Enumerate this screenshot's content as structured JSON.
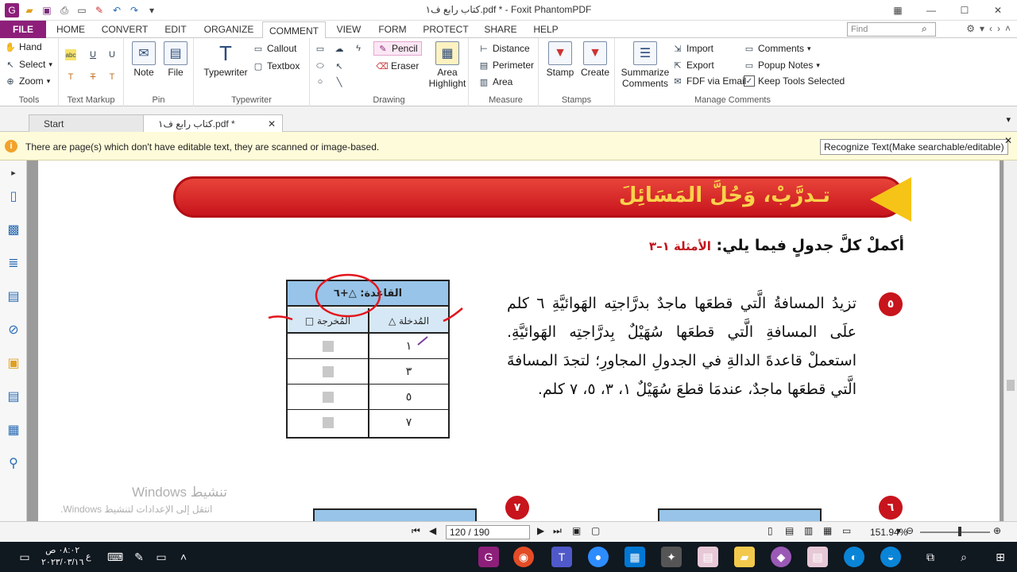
{
  "window": {
    "title": "كتاب رابع ف١.pdf * - Foxit PhantomPDF",
    "qat_icons": [
      "pdf-app-icon",
      "open-folder-icon",
      "save-icon",
      "print-icon",
      "scan-icon",
      "undo-icon",
      "redo-icon",
      "customize-icon"
    ],
    "controls": [
      "restore-icon",
      "minimize-icon",
      "maximize-icon",
      "close-icon"
    ]
  },
  "menu": {
    "file": "FILE",
    "tabs": [
      "HOME",
      "CONVERT",
      "EDIT",
      "ORGANIZE",
      "COMMENT",
      "VIEW",
      "FORM",
      "PROTECT",
      "SHARE",
      "HELP"
    ],
    "active_tab": "COMMENT",
    "find_placeholder": "Find"
  },
  "ribbon": {
    "tools": {
      "hand": "Hand",
      "select": "Select",
      "zoom": "Zoom",
      "label": "Tools"
    },
    "text_markup": {
      "label": "Text Markup"
    },
    "pin": {
      "note": "Note",
      "file": "File",
      "label": "Pin"
    },
    "typewriter": {
      "typewriter": "Typewriter",
      "callout": "Callout",
      "textbox": "Textbox",
      "label": "Typewriter"
    },
    "drawing": {
      "pencil": "Pencil",
      "eraser": "Eraser",
      "area_highlight_1": "Area",
      "area_highlight_2": "Highlight",
      "label": "Drawing"
    },
    "measure": {
      "distance": "Distance",
      "perimeter": "Perimeter",
      "area": "Area",
      "label": "Measure"
    },
    "stamps": {
      "stamp": "Stamp",
      "create": "Create",
      "label": "Stamps"
    },
    "manage": {
      "summarize_1": "Summarize",
      "summarize_2": "Comments",
      "import": "Import",
      "export": "Export",
      "fdf_email": "FDF via Email",
      "comments": "Comments",
      "popup_notes": "Popup Notes",
      "keep_tools": "Keep Tools Selected",
      "label": "Manage Comments"
    }
  },
  "doc_tabs": {
    "start": "Start",
    "current": "كتاب رابع ف١.pdf *"
  },
  "info_bar": {
    "message": "There are page(s) which don't have editable text, they are scanned or image-based.",
    "button": "Recognize Text(Make searchable/editable)"
  },
  "page": {
    "banner": "تـدرَّبْ، وَحُلَّ المَسَائِلَ",
    "instruction": "أكملْ كلَّ جدولٍ فيما يلي:",
    "instruction_ref": "الأمثلة ١–٣",
    "table": {
      "header": "القاعدة: △+٦",
      "col_input": "المُدخلة △",
      "col_output": "المُخرجة □",
      "inputs": [
        "١",
        "٣",
        "٥",
        "٧"
      ]
    },
    "problem_number": "٥",
    "problem_text": "تزيدُ المسافةُ الَّتي قطعَها ماجدٌ بدرَّاجتِه الهَوائيَّةِ ٦ كلم علَى المسافةِ الَّتي قطعَها سُهَيْلٌ بِدرَّاجتِه الهَوائيَّةِ. استعملْ قاعدةَ الدالةِ في الجدولِ المجاورِ؛ لتجدَ المسافةَ الَّتي قطعَها ماجدٌ، عندمَا قطعَ سُهَيْلٌ ١، ٣، ٥، ٧ كلم.",
    "next_numbers": [
      "٧",
      "٦"
    ],
    "watermark_title": "تنشيط Windows",
    "watermark_sub": "انتقل إلى الإعدادات لتنشيط Windows."
  },
  "status": {
    "page_field": "120 / 190",
    "zoom": "151.94%"
  },
  "taskbar": {
    "time": "٠٨:٠٢ ص",
    "date": "٢٠٢٣/٠٣/١٦",
    "lang": "ع"
  }
}
